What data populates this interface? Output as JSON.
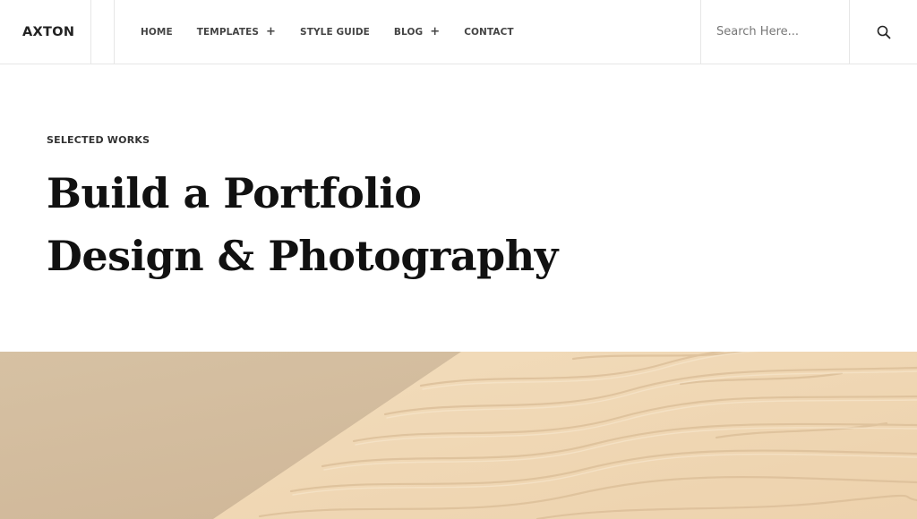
{
  "header": {
    "logo": "AXTON",
    "nav": [
      {
        "label": "HOME",
        "has_submenu": false
      },
      {
        "label": "TEMPLATES",
        "has_submenu": true
      },
      {
        "label": "STYLE GUIDE",
        "has_submenu": false
      },
      {
        "label": "BLOG",
        "has_submenu": true
      },
      {
        "label": "CONTACT",
        "has_submenu": false
      }
    ],
    "submenu_glyph": "+",
    "search": {
      "placeholder": "Search Here...",
      "icon": "search-icon"
    }
  },
  "hero": {
    "eyebrow": "SELECTED WORKS",
    "headline_line1": "Build a Portfolio",
    "headline_line2": "Design & Photography"
  },
  "colors": {
    "text_dark": "#111111",
    "nav_text": "#444444",
    "border": "#e6e6e6",
    "sand_shadow": "#d4bd9e",
    "sand_light": "#f0d8b6"
  }
}
